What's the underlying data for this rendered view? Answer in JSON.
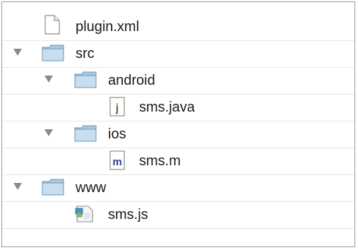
{
  "tree": {
    "items": [
      {
        "label": "plugin.xml",
        "icon": "generic-file-icon"
      },
      {
        "label": "src",
        "icon": "folder-icon",
        "expanded": true
      },
      {
        "label": "android",
        "icon": "folder-icon",
        "expanded": true
      },
      {
        "label": "sms.java",
        "icon": "java-file-icon"
      },
      {
        "label": "ios",
        "icon": "folder-icon",
        "expanded": true
      },
      {
        "label": "sms.m",
        "icon": "objc-file-icon"
      },
      {
        "label": "www",
        "icon": "folder-icon",
        "expanded": true
      },
      {
        "label": "sms.js",
        "icon": "javascript-file-icon"
      }
    ]
  },
  "colors": {
    "folder_fill": "#a9c9e3",
    "folder_border": "#6f93b0",
    "disclosure": "#8a8a8a",
    "text": "#1a1a1a"
  }
}
